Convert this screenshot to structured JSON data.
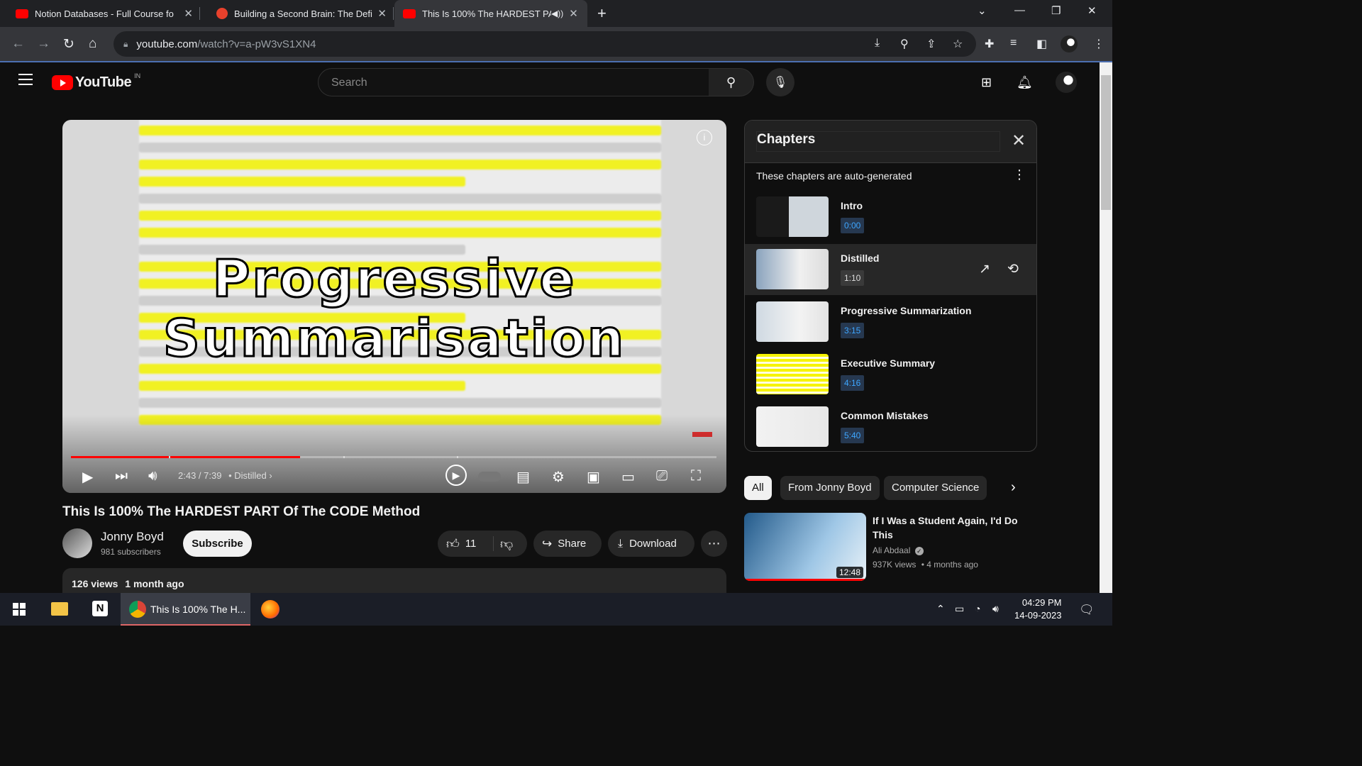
{
  "browser": {
    "tabs": [
      {
        "title": "Notion Databases - Full Course fo",
        "active": false
      },
      {
        "title": "Building a Second Brain: The Defi",
        "active": false
      },
      {
        "title": "This Is 100% The HARDEST PA",
        "active": true
      }
    ],
    "url_host": "youtube.com",
    "url_path": "/watch?v=a-pW3vS1XN4"
  },
  "youtube": {
    "logo_text": "YouTube",
    "country": "IN",
    "search_placeholder": "Search"
  },
  "player": {
    "overlay_line1": "Progressive",
    "overlay_line2": "Summarisation",
    "time": "2:43 / 7:39",
    "chapter_label": "• Distilled",
    "progress_fraction": 0.355
  },
  "video": {
    "title": "This Is 100% The HARDEST PART Of The CODE Method",
    "channel": "Jonny Boyd",
    "subscribers": "981 subscribers",
    "subscribe_label": "Subscribe",
    "likes": "11",
    "share_label": "Share",
    "download_label": "Download",
    "views": "126 views",
    "age": "1 month ago"
  },
  "chapters": {
    "title": "Chapters",
    "subtitle": "These chapters are auto-generated",
    "items": [
      {
        "name": "Intro",
        "time": "0:00"
      },
      {
        "name": "Distilled",
        "time": "1:10"
      },
      {
        "name": "Progressive Summarization",
        "time": "3:15"
      },
      {
        "name": "Executive Summary",
        "time": "4:16"
      },
      {
        "name": "Common Mistakes",
        "time": "5:40"
      }
    ]
  },
  "chips": [
    "All",
    "From Jonny Boyd",
    "Computer Science"
  ],
  "recommendation": {
    "title": "If I Was a Student Again, I'd Do This",
    "channel": "Ali Abdaal",
    "views": "937K views",
    "age": "• 4 months ago",
    "duration": "12:48"
  },
  "taskbar": {
    "active_label": "This Is 100% The H...",
    "time": "04:29 PM",
    "date": "14-09-2023"
  },
  "colors": {
    "brand_red": "#ff0000",
    "chapter_time_blue": "#3ea6ff",
    "highlight_yellow": "#f2f200"
  }
}
